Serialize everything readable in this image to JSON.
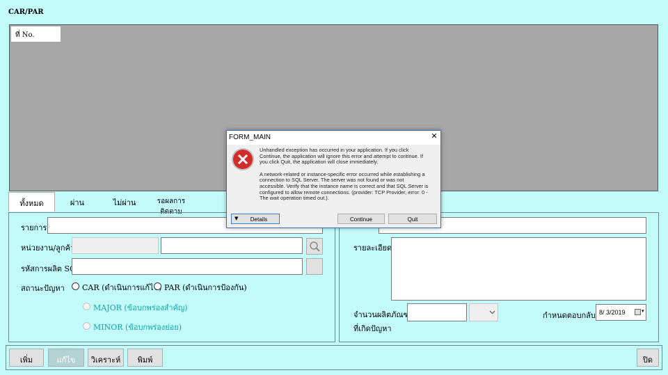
{
  "form_title": "CAR/PAR",
  "grid": {
    "column_header": "ที่ No."
  },
  "tabs": [
    "ทั้งหมด",
    "ผ่าน",
    "ไม่ผ่าน",
    "รอผลการติดตาม"
  ],
  "left_panel": {
    "item_label": "รายการ",
    "unit_customer_label": "หน่วยงาน/ลูกค้า",
    "product_code_label": "รหัสการผลิต SC",
    "problem_status_label": "สถานะปัญหา",
    "radio_car": "CAR (ดำเนินการแก้ไข)",
    "radio_par": "PAR (ดำเนินการป้องกัน)",
    "radio_major": "MAJOR (ข้อบกพร่องสำคัญ)",
    "radio_minor": "MINOR (ข้อบกพร่องย่อย)"
  },
  "right_panel": {
    "detail_label": "รายละเอียด",
    "quantity_label_line1": "จำนวนผลิตภัณฑ์",
    "quantity_label_line2": "ที่เกิดปัญหา",
    "due_label": "กำหนดตอบกลับ",
    "due_date": "8/ 3/2019"
  },
  "bottom_buttons": {
    "add": "เพิ่ม",
    "edit": "แก้ไข",
    "review": "วิเคราะห์",
    "print": "พิมพ์",
    "close": "ปิด"
  },
  "dialog": {
    "title": "FORM_MAIN",
    "message_1": "Unhandled exception has occurred in your application. If you click Continue, the application will ignore this error and attempt to continue. If you click Quit, the application will close immediately.",
    "message_2": "A network-related or instance-specific error occurred while establishing a connection to SQL Server. The server was not found or was not accessible. Verify that the instance name is correct and that SQL Server is configured to allow remote connections. (provider: TCP Provider, error: 0 - The wait operation timed out.).",
    "details_button": "Details",
    "continue_button": "Continue",
    "quit_button": "Quit",
    "icon": "error-icon"
  },
  "colors": {
    "background": "#c3fbfb",
    "grid": "#a6a6a6",
    "error_red": "#d42b2b"
  }
}
